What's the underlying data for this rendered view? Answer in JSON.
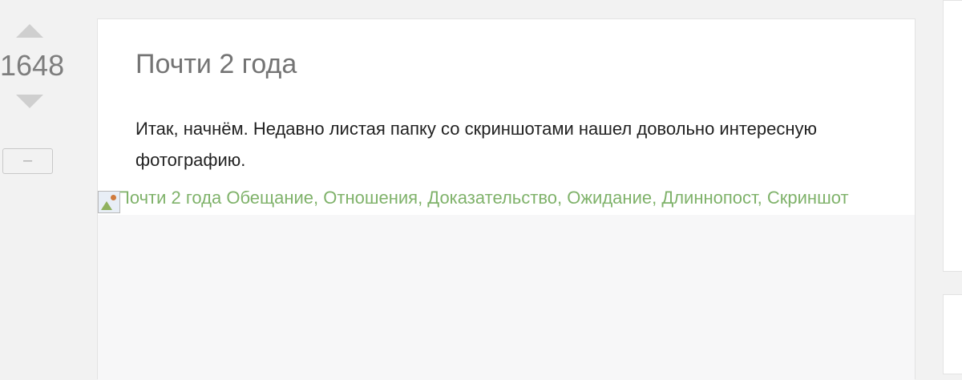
{
  "vote": {
    "rating": "1648",
    "collapse_label": "–",
    "upvote_icon": "triangle-up",
    "downvote_icon": "triangle-down"
  },
  "story": {
    "title": "Почти 2 года",
    "text": "Итак, начнём. Недавно листая папку со скриншотами нашел довольно интересную фотографию.",
    "image_alt": "Почти 2 года Обещание, Отношения, Доказательство, Ожидание, Длиннопост, Скриншот"
  },
  "colors": {
    "background": "#f2f2f2",
    "card": "#ffffff",
    "title": "#747474",
    "text": "#222222",
    "tag_link": "#7fb26a",
    "vote_arrow": "#cfcfcf"
  }
}
